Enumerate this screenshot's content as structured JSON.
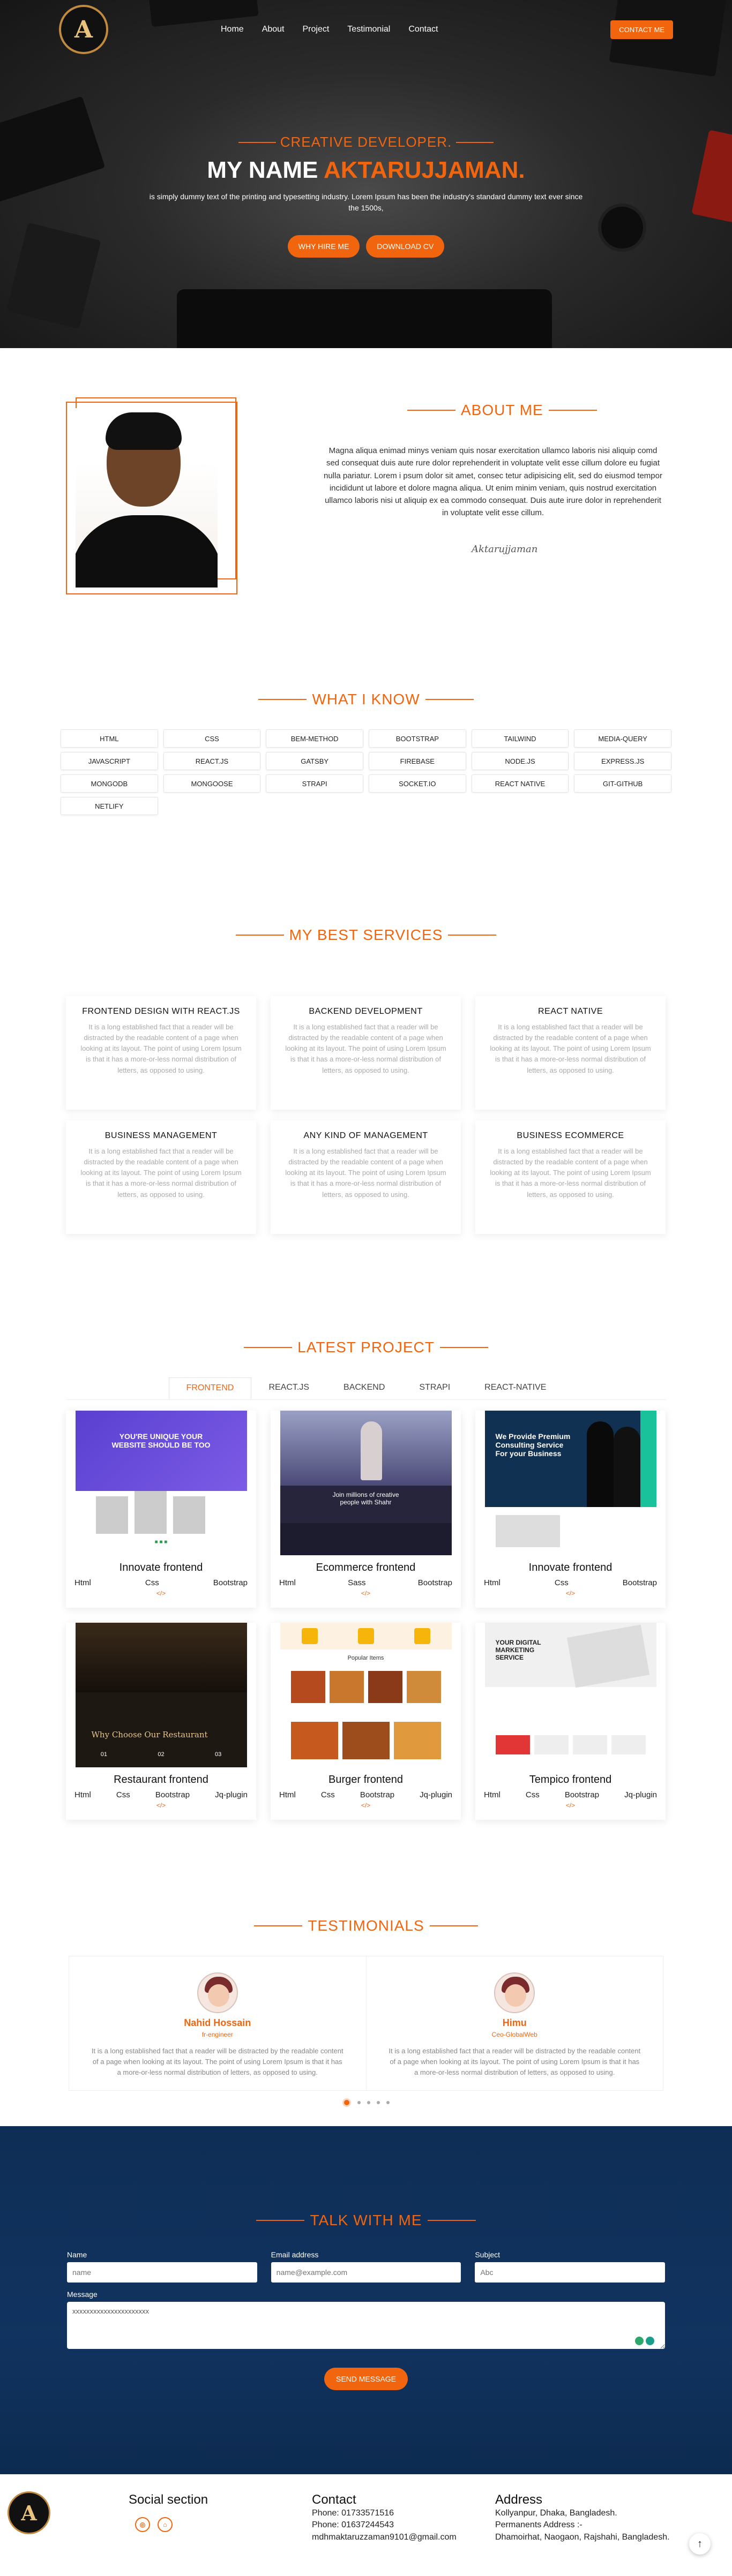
{
  "nav": {
    "logo_letter": "A",
    "links": [
      "Home",
      "About",
      "Project",
      "Testimonial",
      "Contact"
    ],
    "contact_button": "CONTACT ME"
  },
  "hero": {
    "subtitle": "CREATIVE DEVELOPER.",
    "title_prefix": "MY NAME",
    "title_name": "AKTARUJJAMAN.",
    "description": "is simply dummy text of the printing and typesetting industry. Lorem Ipsum has been the industry's standard dummy text ever since the 1500s,",
    "hire_button": "WHY HIRE ME",
    "cv_button": "DOWNLOAD CV"
  },
  "about": {
    "heading": "ABOUT ME",
    "text": "Magna aliqua enimad minys veniam quis nosar exercitation ullamco laboris nisi aliquip comd sed consequat duis aute rure dolor reprehenderit in voluptate velit esse cillum dolore eu fugiat nulla pariatur. Lorem i psum dolor sit amet, consec tetur adipisicing elit, sed do eiusmod tempor incididunt ut labore et dolore magna aliqua. Ut enim minim veniam, quis nostrud exercitation ullamco laboris nisi ut aliquip ex ea commodo consequat. Duis aute irure dolor in reprehenderit in voluptate velit esse cillum.",
    "signature": "Aktarujjaman"
  },
  "know": {
    "heading": "WHAT I KNOW",
    "skills": [
      "HTML",
      "CSS",
      "BEM-METHOD",
      "BOOTSTRAP",
      "TAILWIND",
      "MEDIA-QUERY",
      "JAVASCRIPT",
      "REACT.JS",
      "GATSBY",
      "FIREBASE",
      "NODE.JS",
      "EXPRESS.JS",
      "MONGODB",
      "MONGOOSE",
      "STRAPI",
      "SOCKET.IO",
      "REACT NATIVE",
      "GIT-GITHUB",
      "NETLIFY"
    ]
  },
  "services": {
    "heading": "MY BEST SERVICES",
    "items": [
      {
        "title": "FRONTEND DESIGN WITH REACT.JS",
        "text": "It is a long established fact that a reader will be distracted by the readable content of a page when looking at its layout. The point of using Lorem Ipsum is that it has a more-or-less normal distribution of letters, as opposed to using."
      },
      {
        "title": "BACKEND DEVELOPMENT",
        "text": "It is a long established fact that a reader will be distracted by the readable content of a page when looking at its layout. The point of using Lorem Ipsum is that it has a more-or-less normal distribution of letters, as opposed to using."
      },
      {
        "title": "REACT NATIVE",
        "text": "It is a long established fact that a reader will be distracted by the readable content of a page when looking at its layout. The point of using Lorem Ipsum is that it has a more-or-less normal distribution of letters, as opposed to using."
      },
      {
        "title": "BUSINESS MANAGEMENT",
        "text": "It is a long established fact that a reader will be distracted by the readable content of a page when looking at its layout. The point of using Lorem Ipsum is that it has a more-or-less normal distribution of letters, as opposed to using."
      },
      {
        "title": "ANY KIND OF MANAGEMENT",
        "text": "It is a long established fact that a reader will be distracted by the readable content of a page when looking at its layout. The point of using Lorem Ipsum is that it has a more-or-less normal distribution of letters, as opposed to using."
      },
      {
        "title": "BUSINESS ECOMMERCE",
        "text": "It is a long established fact that a reader will be distracted by the readable content of a page when looking at its layout. The point of using Lorem Ipsum is that it has a more-or-less normal distribution of letters, as opposed to using."
      }
    ]
  },
  "projects": {
    "heading": "LATEST PROJECT",
    "tabs": [
      "FRONTEND",
      "REACT.JS",
      "BACKEND",
      "STRAPI",
      "REACT-NATIVE"
    ],
    "items": [
      {
        "title": "Innovate frontend",
        "tech": [
          "Html",
          "Css",
          "Bootstrap"
        ],
        "shot": "purple",
        "shot_text": "YOU'RE UNIQUE YOUR WEBSITE SHOULD BE TOO"
      },
      {
        "title": "Ecommerce frontend",
        "tech": [
          "Html",
          "Sass",
          "Bootstrap"
        ],
        "shot": "dark",
        "shot_text": "Join millions of creative people with Shahr"
      },
      {
        "title": "Innovate frontend",
        "tech": [
          "Html",
          "Css",
          "Bootstrap"
        ],
        "shot": "navy",
        "shot_text": "We Provide Premium Consulting Service For your Business"
      },
      {
        "title": "Restaurant frontend",
        "tech": [
          "Html",
          "Css",
          "Bootstrap",
          "Jq-plugin"
        ],
        "shot": "restaurant",
        "shot_text": "Why Choose Our Restaurant"
      },
      {
        "title": "Burger frontend",
        "tech": [
          "Html",
          "Css",
          "Bootstrap",
          "Jq-plugin"
        ],
        "shot": "burger",
        "shot_text": "Popular Items"
      },
      {
        "title": "Tempico frontend",
        "tech": [
          "Html",
          "Css",
          "Bootstrap",
          "Jq-plugin"
        ],
        "shot": "tempico",
        "shot_text": "YOUR DIGITAL MARKETING SERVICE"
      }
    ]
  },
  "testimonials": {
    "heading": "TESTIMONIALS",
    "items": [
      {
        "name": "Nahid Hossain",
        "role": "fr-engineer",
        "text": "It is a long established fact that a reader will be distracted by the readable content of a page when looking at its layout. The point of using Lorem Ipsum is that it has a more-or-less normal distribution of letters, as opposed to using."
      },
      {
        "name": "Himu",
        "role": "Ceo-GlobalWeb",
        "text": "It is a long established fact that a reader will be distracted by the readable content of a page when looking at its layout. The point of using Lorem Ipsum is that it has a more-or-less normal distribution of letters, as opposed to using."
      }
    ]
  },
  "talk": {
    "heading": "TALK WITH ME",
    "name_label": "Name",
    "name_placeholder": "name",
    "email_label": "Email address",
    "email_placeholder": "name@example.com",
    "subject_label": "Subject",
    "subject_placeholder": "Abc",
    "message_label": "Message",
    "message_value": "xxxxxxxxxxxxxxxxxxxxxx",
    "send_button": "SEND MESSAGE"
  },
  "footer": {
    "social_heading": "Social section",
    "social_icons": [
      "github-icon",
      "web-icon"
    ],
    "contact_heading": "Contact",
    "phone1": "Phone: 01733571516",
    "phone2": "Phone: 01637244543",
    "email": "mdhmaktaruzzaman9101@gmail.com",
    "address_heading": "Address",
    "address1": "Kollyanpur, Dhaka, Bangladesh.",
    "address2_label": "Permanents Address :-",
    "address2": "Dhamoirhat, Naogaon, Rajshahi, Bangladesh."
  },
  "colors": {
    "accent": "#f2650f",
    "talk_bg": "#0f2e56"
  }
}
